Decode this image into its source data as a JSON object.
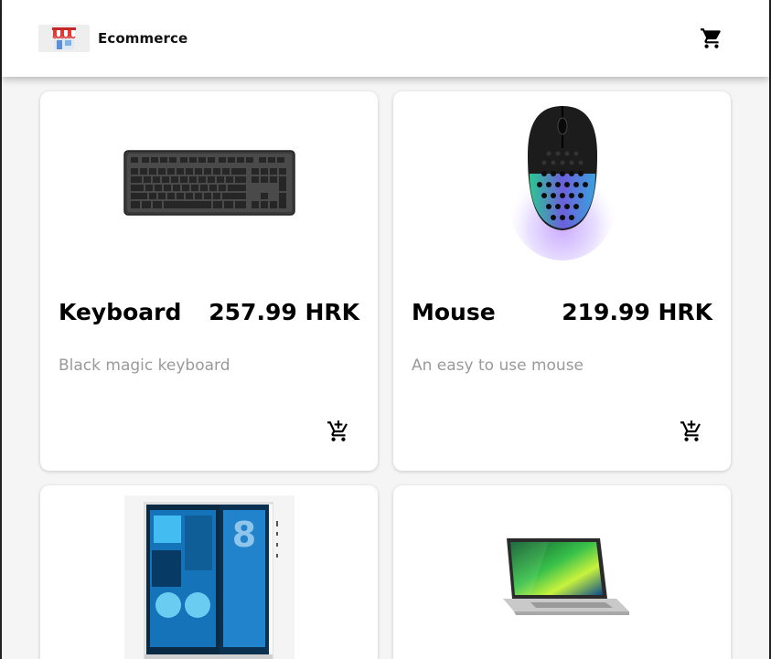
{
  "app": {
    "brand": "Ecommerce",
    "logo_icon": "storefront-icon",
    "cart_icon": "shopping-cart-icon"
  },
  "products": [
    {
      "name": "Keyboard",
      "price": "257.99 HRK",
      "description": "Black magic keyboard",
      "image": "keyboard-image",
      "action_icon": "add-shopping-cart-icon"
    },
    {
      "name": "Mouse",
      "price": "219.99 HRK",
      "description": "An easy to use mouse",
      "image": "gaming-mouse-image",
      "action_icon": "add-shopping-cart-icon"
    },
    {
      "image": "desktop-pc-case-image"
    },
    {
      "image": "laptop-image"
    }
  ]
}
